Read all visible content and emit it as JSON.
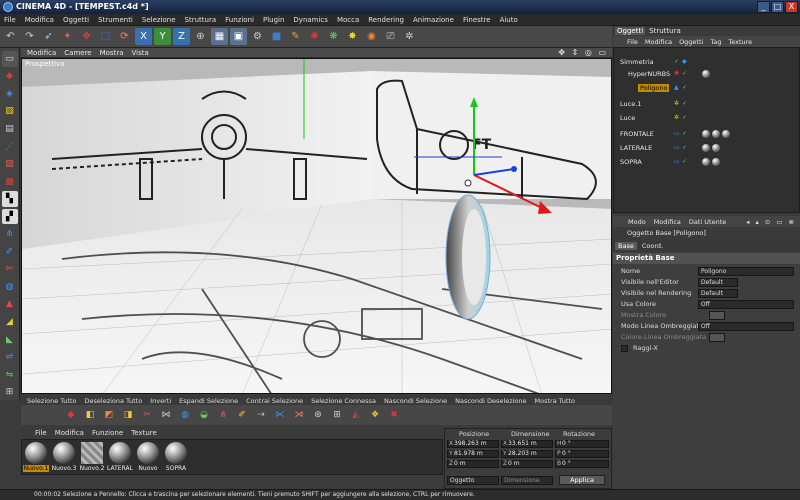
{
  "window": {
    "title": "CINEMA 4D - [TEMPEST.c4d *]",
    "min": "_",
    "max": "□",
    "close": "X"
  },
  "menubar": [
    "File",
    "Modifica",
    "Oggetti",
    "Strumenti",
    "Selezione",
    "Struttura",
    "Funzioni",
    "Plugin",
    "Dynamics",
    "Mocca",
    "Rendering",
    "Animazione",
    "Finestre",
    "Aiuto"
  ],
  "viewport": {
    "menu": [
      "Modifica",
      "Camere",
      "Mostra",
      "Vista"
    ],
    "label": "Prospettiva",
    "nav_icons": "✥ ⇕ ◎ ▭"
  },
  "selection_bar": [
    "Selezione Tutto",
    "Deseleziona Tutto",
    "Inverti",
    "Espandi Selezione",
    "Contrai Selezione",
    "Selezione Connessa",
    "Nascondi Selezione",
    "Nascondi Deselezione",
    "Mostra Tutto"
  ],
  "materials": {
    "menu": [
      "File",
      "Modifica",
      "Funzione",
      "Texture"
    ],
    "items": [
      {
        "name": "Nuovo.1",
        "selected": true
      },
      {
        "name": "Nuovo.3",
        "selected": false
      },
      {
        "name": "Nuovo.2",
        "selected": false
      },
      {
        "name": "LATERAL",
        "selected": false
      },
      {
        "name": "Nuovo",
        "selected": false
      },
      {
        "name": "SOPRA",
        "selected": false
      }
    ]
  },
  "coords": {
    "headers": {
      "pos": "Posizione",
      "dim": "Dimensione",
      "rot": "Rotazione"
    },
    "rows": [
      {
        "ax": "X",
        "pos": "398.263 m",
        "dax": "X",
        "dim": "33.651 m",
        "rax": "H",
        "rot": "0 °"
      },
      {
        "ax": "Y",
        "pos": "81.978 m",
        "dax": "Y",
        "dim": "28.203 m",
        "rax": "P",
        "rot": "0 °"
      },
      {
        "ax": "Z",
        "pos": "0 m",
        "dax": "Z",
        "dim": "0 m",
        "rax": "B",
        "rot": "0 °"
      }
    ],
    "mode1": "Oggetto",
    "mode2": "Dimensione",
    "apply": "Applica"
  },
  "status": "00:00:02   Selezione a Pennello: Clicca e trascina per selezionare elementi. Tieni premuto SHIFT per aggiungere alla selezione, CTRL per rimuovere.",
  "object_manager": {
    "tabs": [
      "Oggetti",
      "Struttura"
    ],
    "menu": [
      "File",
      "Modifica",
      "Oggetti",
      "Tag",
      "Texture"
    ],
    "objects": [
      {
        "name": "Simmetria",
        "indent": 0,
        "check": "✓"
      },
      {
        "name": "HyperNURBS",
        "indent": 1,
        "check": "✓"
      },
      {
        "name": "Poligono",
        "indent": 2,
        "check": "✓"
      },
      {
        "name": "Luce.1",
        "indent": 0,
        "check": "✓"
      },
      {
        "name": "Luce",
        "indent": 0,
        "check": "✓"
      },
      {
        "name": "FRONTALE",
        "indent": 0,
        "check": "✓"
      },
      {
        "name": "LATERALE",
        "indent": 0,
        "check": "✓"
      },
      {
        "name": "SOPRA",
        "indent": 0,
        "check": "✓"
      }
    ]
  },
  "attributes": {
    "menu": [
      "Modo",
      "Modifica",
      "Dati Utente"
    ],
    "header": "Oggetto Base [Poligono]",
    "tabs": [
      "Base",
      "Coord."
    ],
    "section": "Proprietà Base",
    "props": [
      {
        "label": "Nome",
        "value": "Poligono",
        "dim": false
      },
      {
        "label": "Visibile nell'Editor",
        "value": "Default",
        "dim": false
      },
      {
        "label": "Visibile nel Rendering",
        "value": "Default",
        "dim": false
      },
      {
        "label": "Usa Colore",
        "value": "Off",
        "dim": false
      },
      {
        "label": "Mostra Colore",
        "value": "",
        "dim": true
      },
      {
        "label": "Modo Linea Ombreggiata",
        "value": "Off",
        "dim": false
      },
      {
        "label": "Colore Linea Ombreggiata",
        "value": "",
        "dim": true
      },
      {
        "label": "Raggi-X",
        "value": "",
        "dim": false
      }
    ]
  },
  "colors": {
    "accent": "#c48a00",
    "axis_x": "#e01818",
    "axis_y": "#18c818",
    "axis_z": "#1840e0"
  }
}
